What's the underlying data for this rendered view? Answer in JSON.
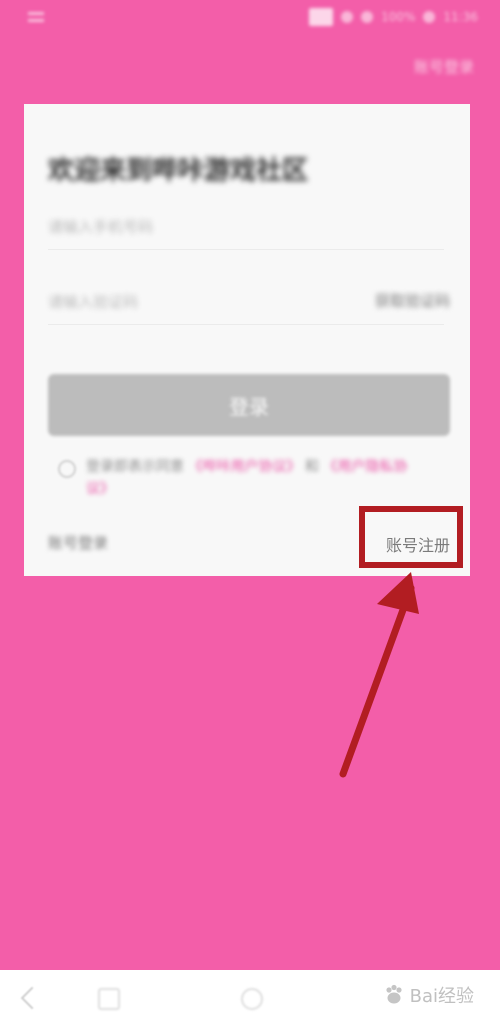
{
  "status_bar": {
    "time": "11:36",
    "battery": "100%"
  },
  "top_right": {
    "label": "账号登录"
  },
  "card": {
    "title": "欢迎来到哔咔游戏社区",
    "phone_placeholder": "请输入手机号码",
    "code_placeholder": "请输入验证码",
    "get_code_label": "获取验证码",
    "login_label": "登录",
    "agreement_prefix": "登录即表示同意",
    "agreement_link_1": "《哔咔用户协议》",
    "agreement_middle": "和",
    "agreement_link_2": "《用户隐私协议》",
    "sms_login_label": "账号登录",
    "register_label": "账号注册"
  },
  "watermark": {
    "text": "Bai经验"
  },
  "colors": {
    "background": "#f35ea9",
    "card": "#f8f8f8",
    "annotation": "#b21d22",
    "link": "#ea4ea4"
  }
}
